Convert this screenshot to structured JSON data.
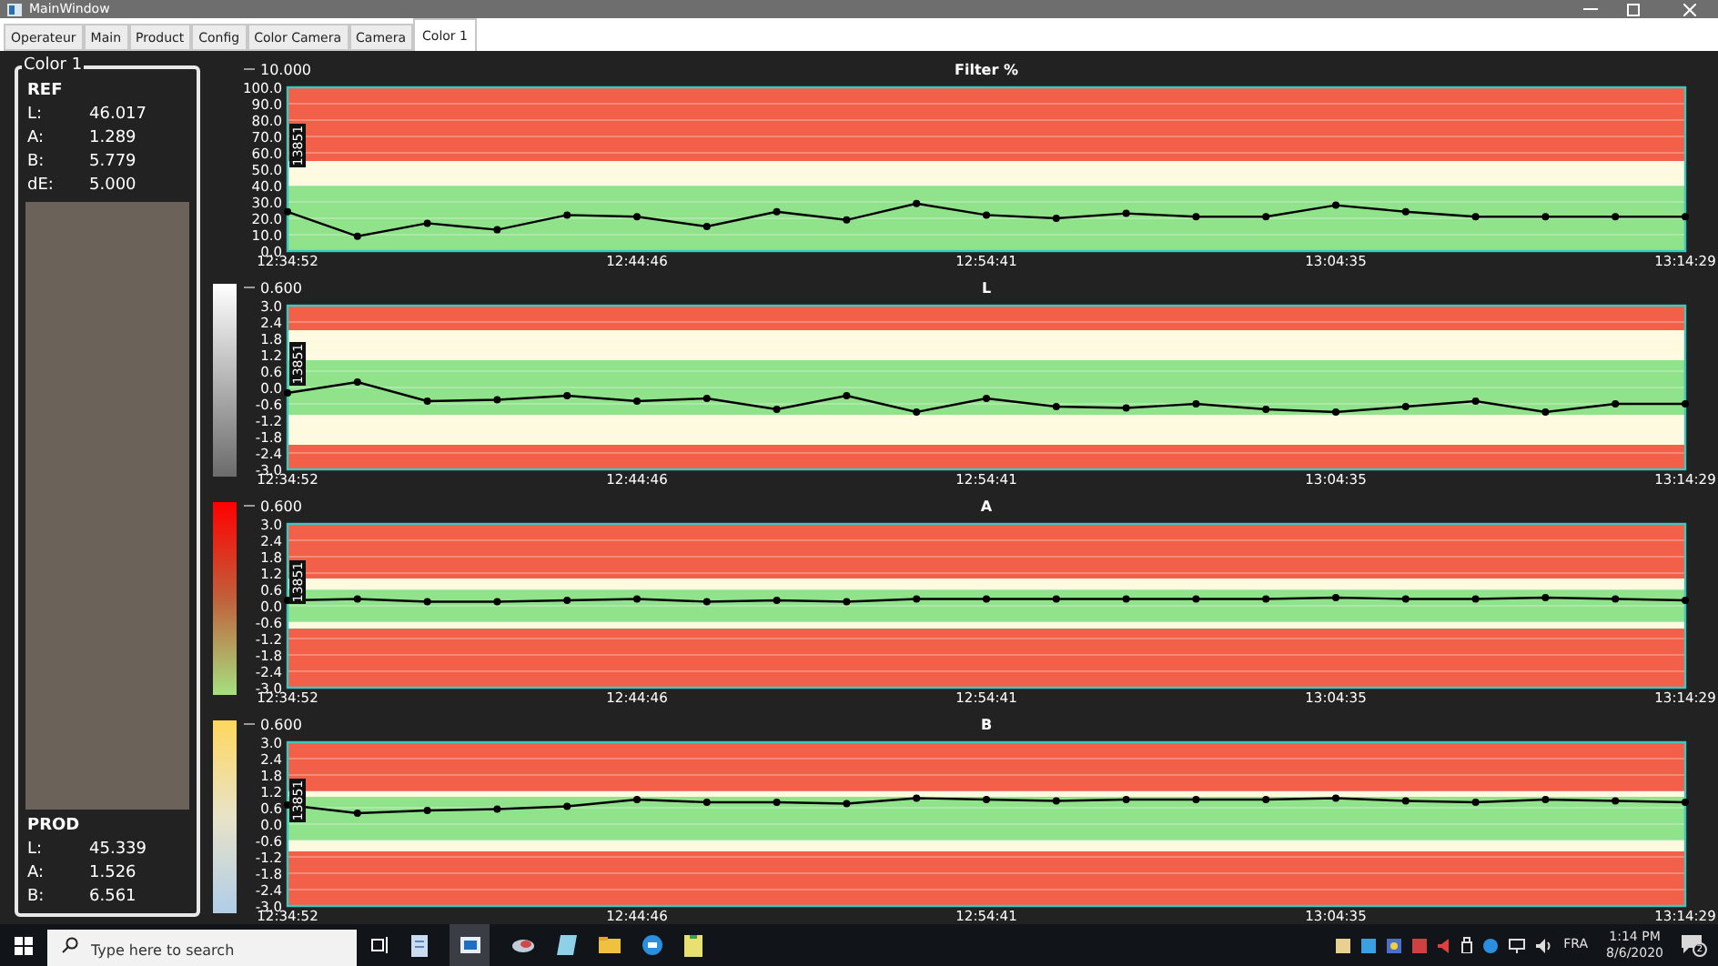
{
  "window": {
    "title": "MainWindow"
  },
  "tabs": [
    {
      "label": "Operateur",
      "selected": false
    },
    {
      "label": "Main",
      "selected": false
    },
    {
      "label": "Product",
      "selected": false
    },
    {
      "label": "Config",
      "selected": false
    },
    {
      "label": "Color Camera",
      "selected": false
    },
    {
      "label": "Camera",
      "selected": false
    },
    {
      "label": "Color 1",
      "selected": true
    }
  ],
  "color_panel": {
    "title": "Color 1",
    "ref": {
      "heading": "REF",
      "rows": [
        {
          "label": "L:",
          "value": "46.017"
        },
        {
          "label": "A:",
          "value": "1.289"
        },
        {
          "label": "B:",
          "value": "5.779"
        },
        {
          "label": "dE:",
          "value": "5.000"
        }
      ]
    },
    "prod": {
      "heading": "PROD",
      "rows": [
        {
          "label": "L:",
          "value": "45.339"
        },
        {
          "label": "A:",
          "value": "1.526"
        },
        {
          "label": "B:",
          "value": "6.561"
        }
      ]
    }
  },
  "charts": [
    {
      "kind": "plain",
      "legend": "10.000",
      "marker_label": "13851",
      "chart_data": {
        "type": "line",
        "title": "Filter %",
        "grid": true,
        "categories": [
          "12:34:52",
          null,
          null,
          null,
          null,
          "12:44:46",
          null,
          null,
          null,
          null,
          "12:54:41",
          null,
          null,
          null,
          null,
          "13:04:35",
          null,
          null,
          null,
          null,
          "13:14:29"
        ],
        "ylim": [
          0,
          100
        ],
        "yticks": [
          {
            "value": 0,
            "label": "0.0"
          },
          {
            "value": 10,
            "label": "10.0"
          },
          {
            "value": 20,
            "label": "20.0"
          },
          {
            "value": 30,
            "label": "30.0"
          },
          {
            "value": 40,
            "label": "40.0"
          },
          {
            "value": 50,
            "label": "50.0"
          },
          {
            "value": 60,
            "label": "60.0"
          },
          {
            "value": 70,
            "label": "70.0"
          },
          {
            "value": 80,
            "label": "80.0"
          },
          {
            "value": 90,
            "label": "90.0"
          },
          {
            "value": 100,
            "label": "100.0"
          }
        ],
        "bands": [
          {
            "axis": "y",
            "from": 55,
            "to": 100,
            "color": "#f2604a"
          },
          {
            "axis": "y",
            "from": 40,
            "to": 55,
            "color": "#fdfae0"
          },
          {
            "axis": "y",
            "from": 0,
            "to": 40,
            "color": "#90e28b"
          }
        ],
        "series": [
          {
            "color": "#000000",
            "marker": "o",
            "values": [
              24,
              9,
              17,
              13,
              22,
              21,
              15,
              24,
              19,
              29,
              22,
              20,
              23,
              21,
              21,
              28,
              24,
              21,
              21,
              21,
              21
            ]
          }
        ]
      }
    },
    {
      "kind": "gray_scale",
      "legend": "0.600",
      "marker_label": "13851",
      "chart_data": {
        "type": "line",
        "title": "L",
        "grid": true,
        "categories": [
          "12:34:52",
          null,
          null,
          null,
          null,
          "12:44:46",
          null,
          null,
          null,
          null,
          "12:54:41",
          null,
          null,
          null,
          null,
          "13:04:35",
          null,
          null,
          null,
          null,
          "13:14:29"
        ],
        "ylim": [
          -3,
          3
        ],
        "yticks": [
          {
            "value": -3,
            "label": "-3.0"
          },
          {
            "value": -2.4,
            "label": "-2.4"
          },
          {
            "value": -1.8,
            "label": "-1.8"
          },
          {
            "value": -1.2,
            "label": "-1.2"
          },
          {
            "value": -0.6,
            "label": "-0.6"
          },
          {
            "value": 0,
            "label": "0.0"
          },
          {
            "value": 0.6,
            "label": "0.6"
          },
          {
            "value": 1.2,
            "label": "1.2"
          },
          {
            "value": 1.8,
            "label": "1.8"
          },
          {
            "value": 2.4,
            "label": "2.4"
          },
          {
            "value": 3,
            "label": "3.0"
          }
        ],
        "bands": [
          {
            "axis": "y",
            "from": 2.1,
            "to": 3,
            "color": "#f2604a"
          },
          {
            "axis": "y",
            "from": 1.0,
            "to": 2.1,
            "color": "#fdfae0"
          },
          {
            "axis": "y",
            "from": -1.0,
            "to": 1.0,
            "color": "#90e28b"
          },
          {
            "axis": "y",
            "from": -2.1,
            "to": -1.0,
            "color": "#fdfae0"
          },
          {
            "axis": "y",
            "from": -3,
            "to": -2.1,
            "color": "#f2604a"
          }
        ],
        "series": [
          {
            "color": "#000000",
            "marker": "o",
            "values": [
              -0.2,
              0.2,
              -0.5,
              -0.45,
              -0.3,
              -0.5,
              -0.4,
              -0.8,
              -0.3,
              -0.9,
              -0.4,
              -0.7,
              -0.75,
              -0.6,
              -0.8,
              -0.9,
              -0.7,
              -0.5,
              -0.9,
              -0.6,
              -0.6
            ]
          }
        ]
      }
    },
    {
      "kind": "red_green_scale",
      "legend": "0.600",
      "marker_label": "13851",
      "chart_data": {
        "type": "line",
        "title": "A",
        "grid": true,
        "categories": [
          "12:34:52",
          null,
          null,
          null,
          null,
          "12:44:46",
          null,
          null,
          null,
          null,
          "12:54:41",
          null,
          null,
          null,
          null,
          "13:04:35",
          null,
          null,
          null,
          null,
          "13:14:29"
        ],
        "ylim": [
          -3,
          3
        ],
        "yticks": [
          {
            "value": -3,
            "label": "-3.0"
          },
          {
            "value": -2.4,
            "label": "-2.4"
          },
          {
            "value": -1.8,
            "label": "-1.8"
          },
          {
            "value": -1.2,
            "label": "-1.2"
          },
          {
            "value": -0.6,
            "label": "-0.6"
          },
          {
            "value": 0,
            "label": "0.0"
          },
          {
            "value": 0.6,
            "label": "0.6"
          },
          {
            "value": 1.2,
            "label": "1.2"
          },
          {
            "value": 1.8,
            "label": "1.8"
          },
          {
            "value": 2.4,
            "label": "2.4"
          },
          {
            "value": 3,
            "label": "3.0"
          }
        ],
        "bands": [
          {
            "axis": "y",
            "from": 1.0,
            "to": 3,
            "color": "#f2604a"
          },
          {
            "axis": "y",
            "from": 0.6,
            "to": 1.0,
            "color": "#fdfae0"
          },
          {
            "axis": "y",
            "from": -0.6,
            "to": 0.6,
            "color": "#90e28b"
          },
          {
            "axis": "y",
            "from": -0.85,
            "to": -0.6,
            "color": "#fdfae0"
          },
          {
            "axis": "y",
            "from": -3,
            "to": -0.85,
            "color": "#f2604a"
          }
        ],
        "series": [
          {
            "color": "#000000",
            "marker": "o",
            "values": [
              0.2,
              0.25,
              0.15,
              0.15,
              0.2,
              0.25,
              0.15,
              0.2,
              0.15,
              0.25,
              0.25,
              0.25,
              0.25,
              0.25,
              0.25,
              0.3,
              0.25,
              0.25,
              0.3,
              0.25,
              0.2
            ]
          }
        ]
      }
    },
    {
      "kind": "yellow_blue_scale",
      "legend": "0.600",
      "marker_label": "13851",
      "chart_data": {
        "type": "line",
        "title": "B",
        "grid": true,
        "categories": [
          "12:34:52",
          null,
          null,
          null,
          null,
          "12:44:46",
          null,
          null,
          null,
          null,
          "12:54:41",
          null,
          null,
          null,
          null,
          "13:04:35",
          null,
          null,
          null,
          null,
          "13:14:29"
        ],
        "ylim": [
          -3,
          3
        ],
        "yticks": [
          {
            "value": -3,
            "label": "-3.0"
          },
          {
            "value": -2.4,
            "label": "-2.4"
          },
          {
            "value": -1.8,
            "label": "-1.8"
          },
          {
            "value": -1.2,
            "label": "-1.2"
          },
          {
            "value": -0.6,
            "label": "-0.6"
          },
          {
            "value": 0,
            "label": "0.0"
          },
          {
            "value": 0.6,
            "label": "0.6"
          },
          {
            "value": 1.2,
            "label": "1.2"
          },
          {
            "value": 1.8,
            "label": "1.8"
          },
          {
            "value": 2.4,
            "label": "2.4"
          },
          {
            "value": 3,
            "label": "3.0"
          }
        ],
        "bands": [
          {
            "axis": "y",
            "from": 1.2,
            "to": 3,
            "color": "#f2604a"
          },
          {
            "axis": "y",
            "from": 1.0,
            "to": 1.2,
            "color": "#fdfae0"
          },
          {
            "axis": "y",
            "from": -0.6,
            "to": 1.0,
            "color": "#90e28b"
          },
          {
            "axis": "y",
            "from": -1.0,
            "to": -0.6,
            "color": "#fdfae0"
          },
          {
            "axis": "y",
            "from": -3,
            "to": -1.0,
            "color": "#f2604a"
          }
        ],
        "series": [
          {
            "color": "#000000",
            "marker": "o",
            "values": [
              0.7,
              0.4,
              0.5,
              0.55,
              0.65,
              0.9,
              0.8,
              0.8,
              0.75,
              0.95,
              0.9,
              0.85,
              0.9,
              0.9,
              0.9,
              0.95,
              0.85,
              0.8,
              0.9,
              0.85,
              0.8
            ]
          }
        ]
      }
    }
  ],
  "taskbar": {
    "search_placeholder": "Type here to search",
    "language": "FRA",
    "time": "1:14 PM",
    "date": "8/6/2020",
    "notifications": "2"
  }
}
